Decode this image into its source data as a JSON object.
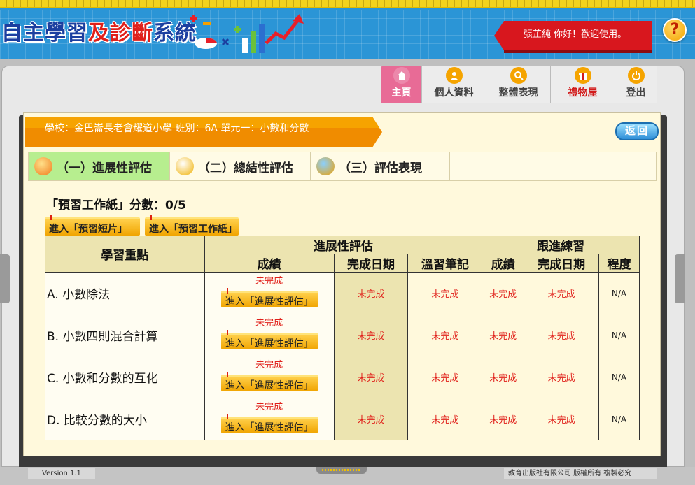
{
  "header": {
    "title_part1": "自主學習",
    "title_part2": "及診斷",
    "title_part3": "系統",
    "welcome": "張芷純  你好！歡迎使用。",
    "help_label": "?"
  },
  "nav": {
    "home": "主頁",
    "profile": "個人資料",
    "performance": "整體表現",
    "gift": "禮物屋",
    "logout": "登出"
  },
  "info": {
    "text": "學校：金巴崙長老會耀道小學  班別：6A  單元一：小數和分數",
    "back": "返回"
  },
  "tabs": [
    {
      "label": "（一）進展性評估"
    },
    {
      "label": "（二）總結性評估"
    },
    {
      "label": "（三）評估表現"
    }
  ],
  "score_line": "「預習工作紙」分數：0/5",
  "buttons": {
    "video": "進入「預習短片」",
    "sheet": "進入「預習工作紙」"
  },
  "table": {
    "header_topic": "學習重點",
    "header_group1": "進展性評估",
    "header_group2": "跟進練習",
    "sub_headers": [
      "成績",
      "完成日期",
      "溫習筆記",
      "成績",
      "完成日期",
      "程度"
    ],
    "rows": [
      {
        "topic": "A. 小數除法",
        "score_status": "未完成",
        "enter": "進入「進展性評估」",
        "date": "未完成",
        "notes": "未完成",
        "f_score": "未完成",
        "f_date": "未完成",
        "level": "N/A"
      },
      {
        "topic": "B. 小數四則混合計算",
        "score_status": "未完成",
        "enter": "進入「進展性評估」",
        "date": "未完成",
        "notes": "未完成",
        "f_score": "未完成",
        "f_date": "未完成",
        "level": "N/A"
      },
      {
        "topic": "C. 小數和分數的互化",
        "score_status": "未完成",
        "enter": "進入「進展性評估」",
        "date": "未完成",
        "notes": "未完成",
        "f_score": "未完成",
        "f_date": "未完成",
        "level": "N/A"
      },
      {
        "topic": "D. 比較分數的大小",
        "score_status": "未完成",
        "enter": "進入「進展性評估」",
        "date": "未完成",
        "notes": "未完成",
        "f_score": "未完成",
        "f_date": "未完成",
        "level": "N/A"
      }
    ]
  },
  "footer": {
    "version": "Version 1.1",
    "copyright": "教育出版社有限公司  版權所有  複製必究"
  }
}
